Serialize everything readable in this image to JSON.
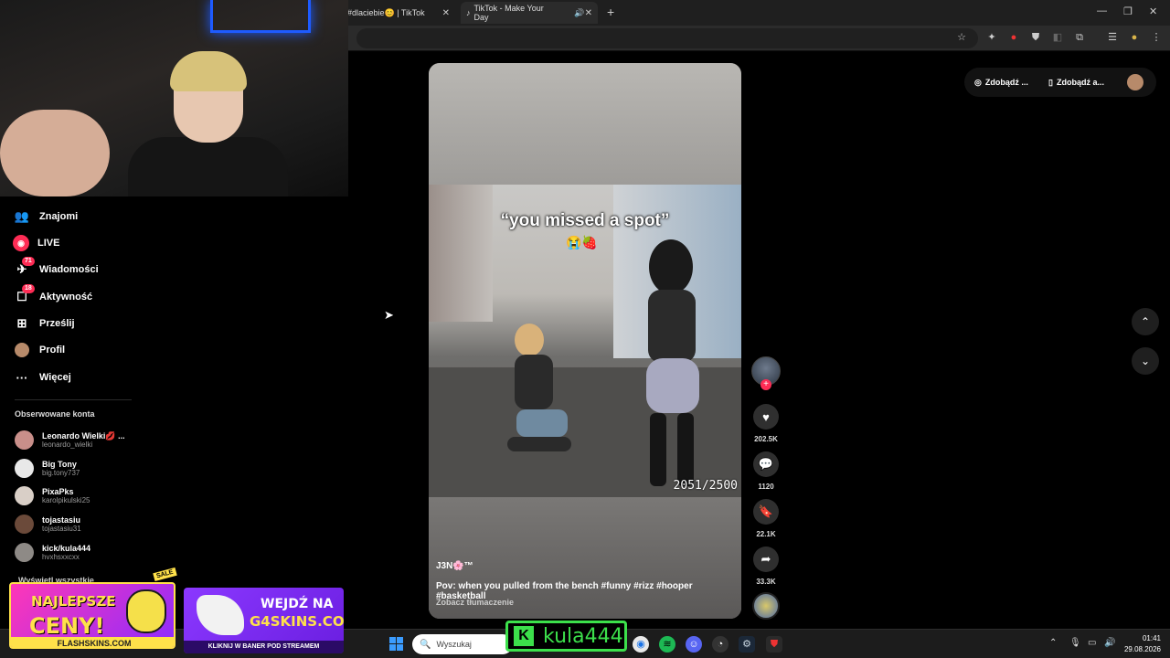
{
  "browser": {
    "tabs": [
      {
        "label": "#dlaciebie😊 | TikTok"
      },
      {
        "label": "TikTok - Make Your Day"
      }
    ],
    "new_tab": "+",
    "window_controls": [
      "—",
      "❐",
      "✕"
    ]
  },
  "sidebar": {
    "items": [
      {
        "label": "Znajomi",
        "icon": "friends-icon"
      },
      {
        "label": "LIVE",
        "icon": "live-icon"
      },
      {
        "label": "Wiadomości",
        "icon": "messages-icon",
        "badge": "71"
      },
      {
        "label": "Aktywność",
        "icon": "activity-icon",
        "badge": "18"
      },
      {
        "label": "Prześlij",
        "icon": "upload-icon"
      },
      {
        "label": "Profil",
        "icon": "profile-icon"
      },
      {
        "label": "Więcej",
        "icon": "more-icon"
      }
    ],
    "following_title": "Obserwowane konta",
    "accounts": [
      {
        "name": "Leonardo Wielki💋 ...",
        "handle": "leonardo_wielki"
      },
      {
        "name": "Big Tony",
        "handle": "big.tony737"
      },
      {
        "name": "PixaPks",
        "handle": "karolpikulski25"
      },
      {
        "name": "tojastasiu",
        "handle": "tojastasiu31"
      },
      {
        "name": "kick/kula444",
        "handle": "hvxhsxxcxx"
      }
    ],
    "show_all": "Wyświetl wszystkie"
  },
  "video": {
    "overlay_text": "“you missed a spot”",
    "emoji": "😭🍓",
    "counter": "2051/2500",
    "author": "J3N🌸™",
    "caption": "Pov: when you pulled from the bench #funny #rizz #hooper #basketball",
    "translate": "Zobacz tłumaczenie"
  },
  "actions": {
    "likes": "202.5K",
    "comments": "1120",
    "saves": "22.1K",
    "shares": "33.3K"
  },
  "top_right": {
    "get_coins": "Zdobądź ...",
    "get_app": "Zdobądź a..."
  },
  "taskbar": {
    "search_placeholder": "Wyszukaj",
    "time": "01:41",
    "date": "29.08.2026"
  },
  "overlays": {
    "kula_name": "kula444",
    "ad1_line1": "NAJLEPSZE",
    "ad1_line2": "CENY!",
    "ad1_brand": "FLASHSKINS.COM",
    "ad1_tag": "SALE",
    "ad2_line1": "WEJDŹ NA",
    "ad2_line2": "G4SKINS.COM",
    "ad2_line3": "KLIKNIJ W BANER POD STREAMEM"
  }
}
